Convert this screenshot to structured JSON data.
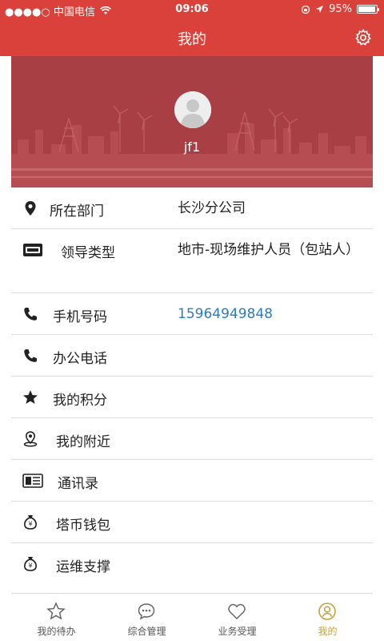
{
  "status_bar": {
    "carrier": "●●●●○ 中国电信",
    "time": "09:06",
    "battery": "95%",
    "battery_level": 0.95
  },
  "nav": {
    "title": "我的"
  },
  "profile": {
    "username": "jf1"
  },
  "info": [
    {
      "label": "所在部门",
      "value": "长沙分公司",
      "icon": "location-pin-icon"
    },
    {
      "label": "领导类型",
      "value": "地市-现场维护人员（包站人）",
      "icon": "id-card-icon"
    },
    {
      "label": "手机号码",
      "value": "15964949848",
      "icon": "phone-icon"
    },
    {
      "label": "办公电话",
      "value": "",
      "icon": "phone-icon"
    },
    {
      "label": "我的积分",
      "value": "",
      "icon": "star-icon"
    },
    {
      "label": "我的附近",
      "value": "",
      "icon": "nearby-pin-icon"
    },
    {
      "label": "通讯录",
      "value": "",
      "icon": "contacts-icon"
    },
    {
      "label": "塔币钱包",
      "value": "",
      "icon": "money-bag-icon"
    },
    {
      "label": "运维支撑",
      "value": "",
      "icon": "money-bag-icon"
    }
  ],
  "tabs": [
    {
      "label": "我的待办",
      "icon": "star-outline-icon"
    },
    {
      "label": "综合管理",
      "icon": "chat-bubble-icon"
    },
    {
      "label": "业务受理",
      "icon": "heart-outline-icon"
    },
    {
      "label": "我的",
      "icon": "user-circle-icon",
      "active": true
    }
  ],
  "colors": {
    "header_red": "#d9413a",
    "banner_red": "#a83f44",
    "phone_link": "#2a7cc2",
    "tab_active": "#c7a137"
  }
}
